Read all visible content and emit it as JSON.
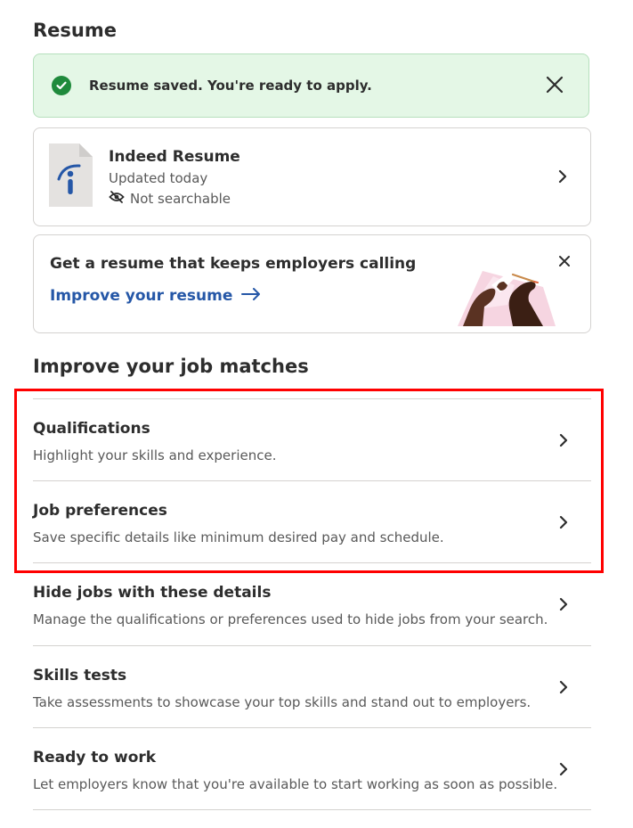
{
  "resume": {
    "section_title": "Resume",
    "alert": {
      "message": "Resume saved. You're ready to apply."
    },
    "card": {
      "name": "Indeed Resume",
      "updated": "Updated today",
      "searchable": "Not searchable"
    },
    "promo": {
      "headline": "Get a resume that keeps employers calling",
      "link_label": "Improve your resume"
    }
  },
  "job_matches": {
    "section_title": "Improve your job matches",
    "items": [
      {
        "title": "Qualifications",
        "description": "Highlight your skills and experience."
      },
      {
        "title": "Job preferences",
        "description": "Save specific details like minimum desired pay and schedule."
      },
      {
        "title": "Hide jobs with these details",
        "description": "Manage the qualifications or preferences used to hide jobs from your search."
      },
      {
        "title": "Skills tests",
        "description": "Take assessments to showcase your top skills and stand out to employers."
      },
      {
        "title": "Ready to work",
        "description": "Let employers know that you're available to start working as soon as possible."
      }
    ]
  },
  "icons": {
    "success": "check-circle-icon",
    "close": "close-icon",
    "chevron": "chevron-right-icon",
    "not_searchable": "eye-off-icon",
    "arrow": "arrow-right-icon",
    "document": "indeed-document-icon"
  },
  "colors": {
    "success_bg": "#e4f7e6",
    "success_green": "#1f8a3c",
    "link_blue": "#2557a7",
    "highlight_red": "#ff0000"
  }
}
